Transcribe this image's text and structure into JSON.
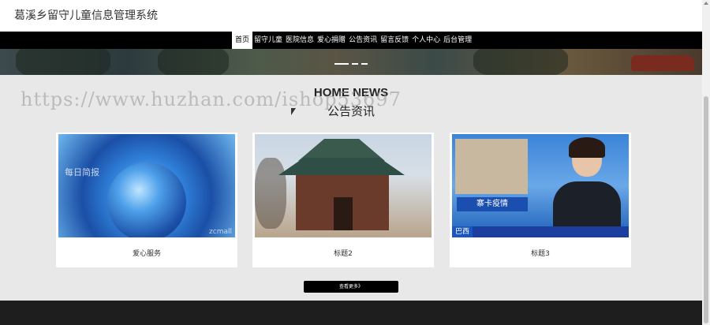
{
  "header": {
    "site_title": "葛溪乡留守儿童信息管理系统"
  },
  "nav": {
    "items": [
      "首页",
      "留守儿童",
      "医院信息",
      "爱心捐赠",
      "公告资讯",
      "留言反馈",
      "个人中心",
      "后台管理"
    ],
    "active_index": 0
  },
  "news": {
    "heading_en": "HOME NEWS",
    "heading_cn": "公告资讯",
    "cards": [
      {
        "label": "爱心服务",
        "image_text": "每日简报",
        "image_logo": "zcmall"
      },
      {
        "label": "标题2"
      },
      {
        "label": "标题3",
        "image_caption": "寨卡疫情",
        "image_ticker": "巴西"
      }
    ],
    "more_label": "查看更多》"
  },
  "watermark": "https://www.huzhan.com/ishop53697",
  "colors": {
    "nav_bg": "#000000",
    "page_bg": "#e8e8e8",
    "footer_bg": "#1e1e1e"
  }
}
